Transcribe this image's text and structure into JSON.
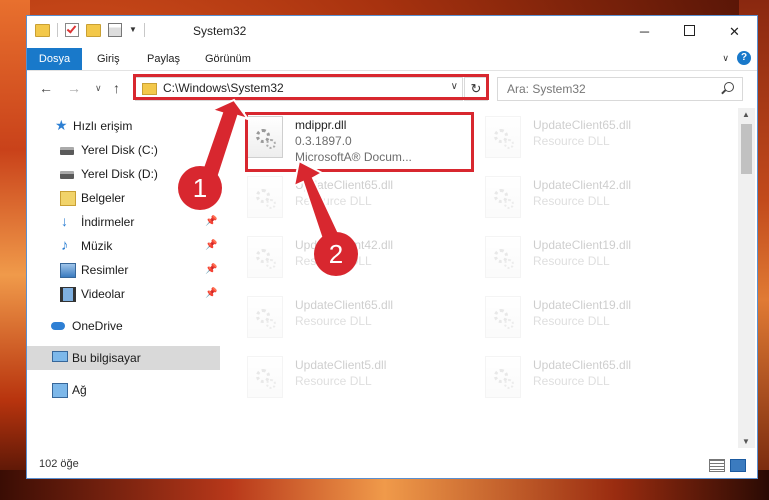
{
  "window": {
    "title": "System32",
    "controls": {
      "minimize": "─",
      "maximize": "",
      "close": "✕"
    }
  },
  "ribbon": {
    "tabs": [
      "Dosya",
      "Giriş",
      "Paylaş",
      "Görünüm"
    ],
    "help": "?",
    "caret": "∨"
  },
  "navbar": {
    "back": "←",
    "forward": "→",
    "recent": "∨",
    "up": "↑",
    "address": "C:\\Windows\\System32",
    "address_chevron": "∨",
    "refresh": "↻",
    "search_placeholder": "Ara: System32"
  },
  "sidebar": {
    "items": [
      {
        "label": "Hızlı erişim",
        "icon": "star-icon",
        "pinned": false
      },
      {
        "label": "Yerel Disk (C:)",
        "icon": "disk-icon",
        "pinned": false
      },
      {
        "label": "Yerel Disk (D:)",
        "icon": "disk-icon",
        "pinned": false
      },
      {
        "label": "Belgeler",
        "icon": "documents-icon",
        "pinned": true
      },
      {
        "label": "İndirmeler",
        "icon": "downloads-icon",
        "pinned": true
      },
      {
        "label": "Müzik",
        "icon": "music-icon",
        "pinned": true
      },
      {
        "label": "Resimler",
        "icon": "pictures-icon",
        "pinned": true
      },
      {
        "label": "Videolar",
        "icon": "videos-icon",
        "pinned": true
      },
      {
        "label": "OneDrive",
        "icon": "cloud-icon",
        "pinned": false
      },
      {
        "label": "Bu bilgisayar",
        "icon": "computer-icon",
        "pinned": false,
        "selected": true
      },
      {
        "label": "Ağ",
        "icon": "network-icon",
        "pinned": false
      }
    ],
    "pin_glyph": "📌"
  },
  "files": [
    {
      "name": "mdippr.dll",
      "line2": "0.3.1897.0",
      "line3": "MicrosoftA® Docum...",
      "highlighted": true
    },
    {
      "name": "UpdateClient65.dll",
      "line2": "Resource DLL"
    },
    {
      "name": "UpdateClient65.dll",
      "line2": "Resource DLL"
    },
    {
      "name": "UpdateClient42.dll",
      "line2": "Resource DLL"
    },
    {
      "name": "UpdateClient42.dll",
      "line2": "Resource DLL"
    },
    {
      "name": "UpdateClient19.dll",
      "line2": "Resource DLL"
    },
    {
      "name": "UpdateClient65.dll",
      "line2": "Resource DLL"
    },
    {
      "name": "UpdateClient19.dll",
      "line2": "Resource DLL"
    },
    {
      "name": "UpdateClient5.dll",
      "line2": "Resource DLL"
    },
    {
      "name": "UpdateClient65.dll",
      "line2": "Resource DLL"
    }
  ],
  "status": {
    "count": "102 öğe"
  },
  "callouts": [
    "1",
    "2"
  ],
  "colors": {
    "accent": "#1979ca",
    "highlight": "#d8272f",
    "selection": "#cce8ff"
  }
}
